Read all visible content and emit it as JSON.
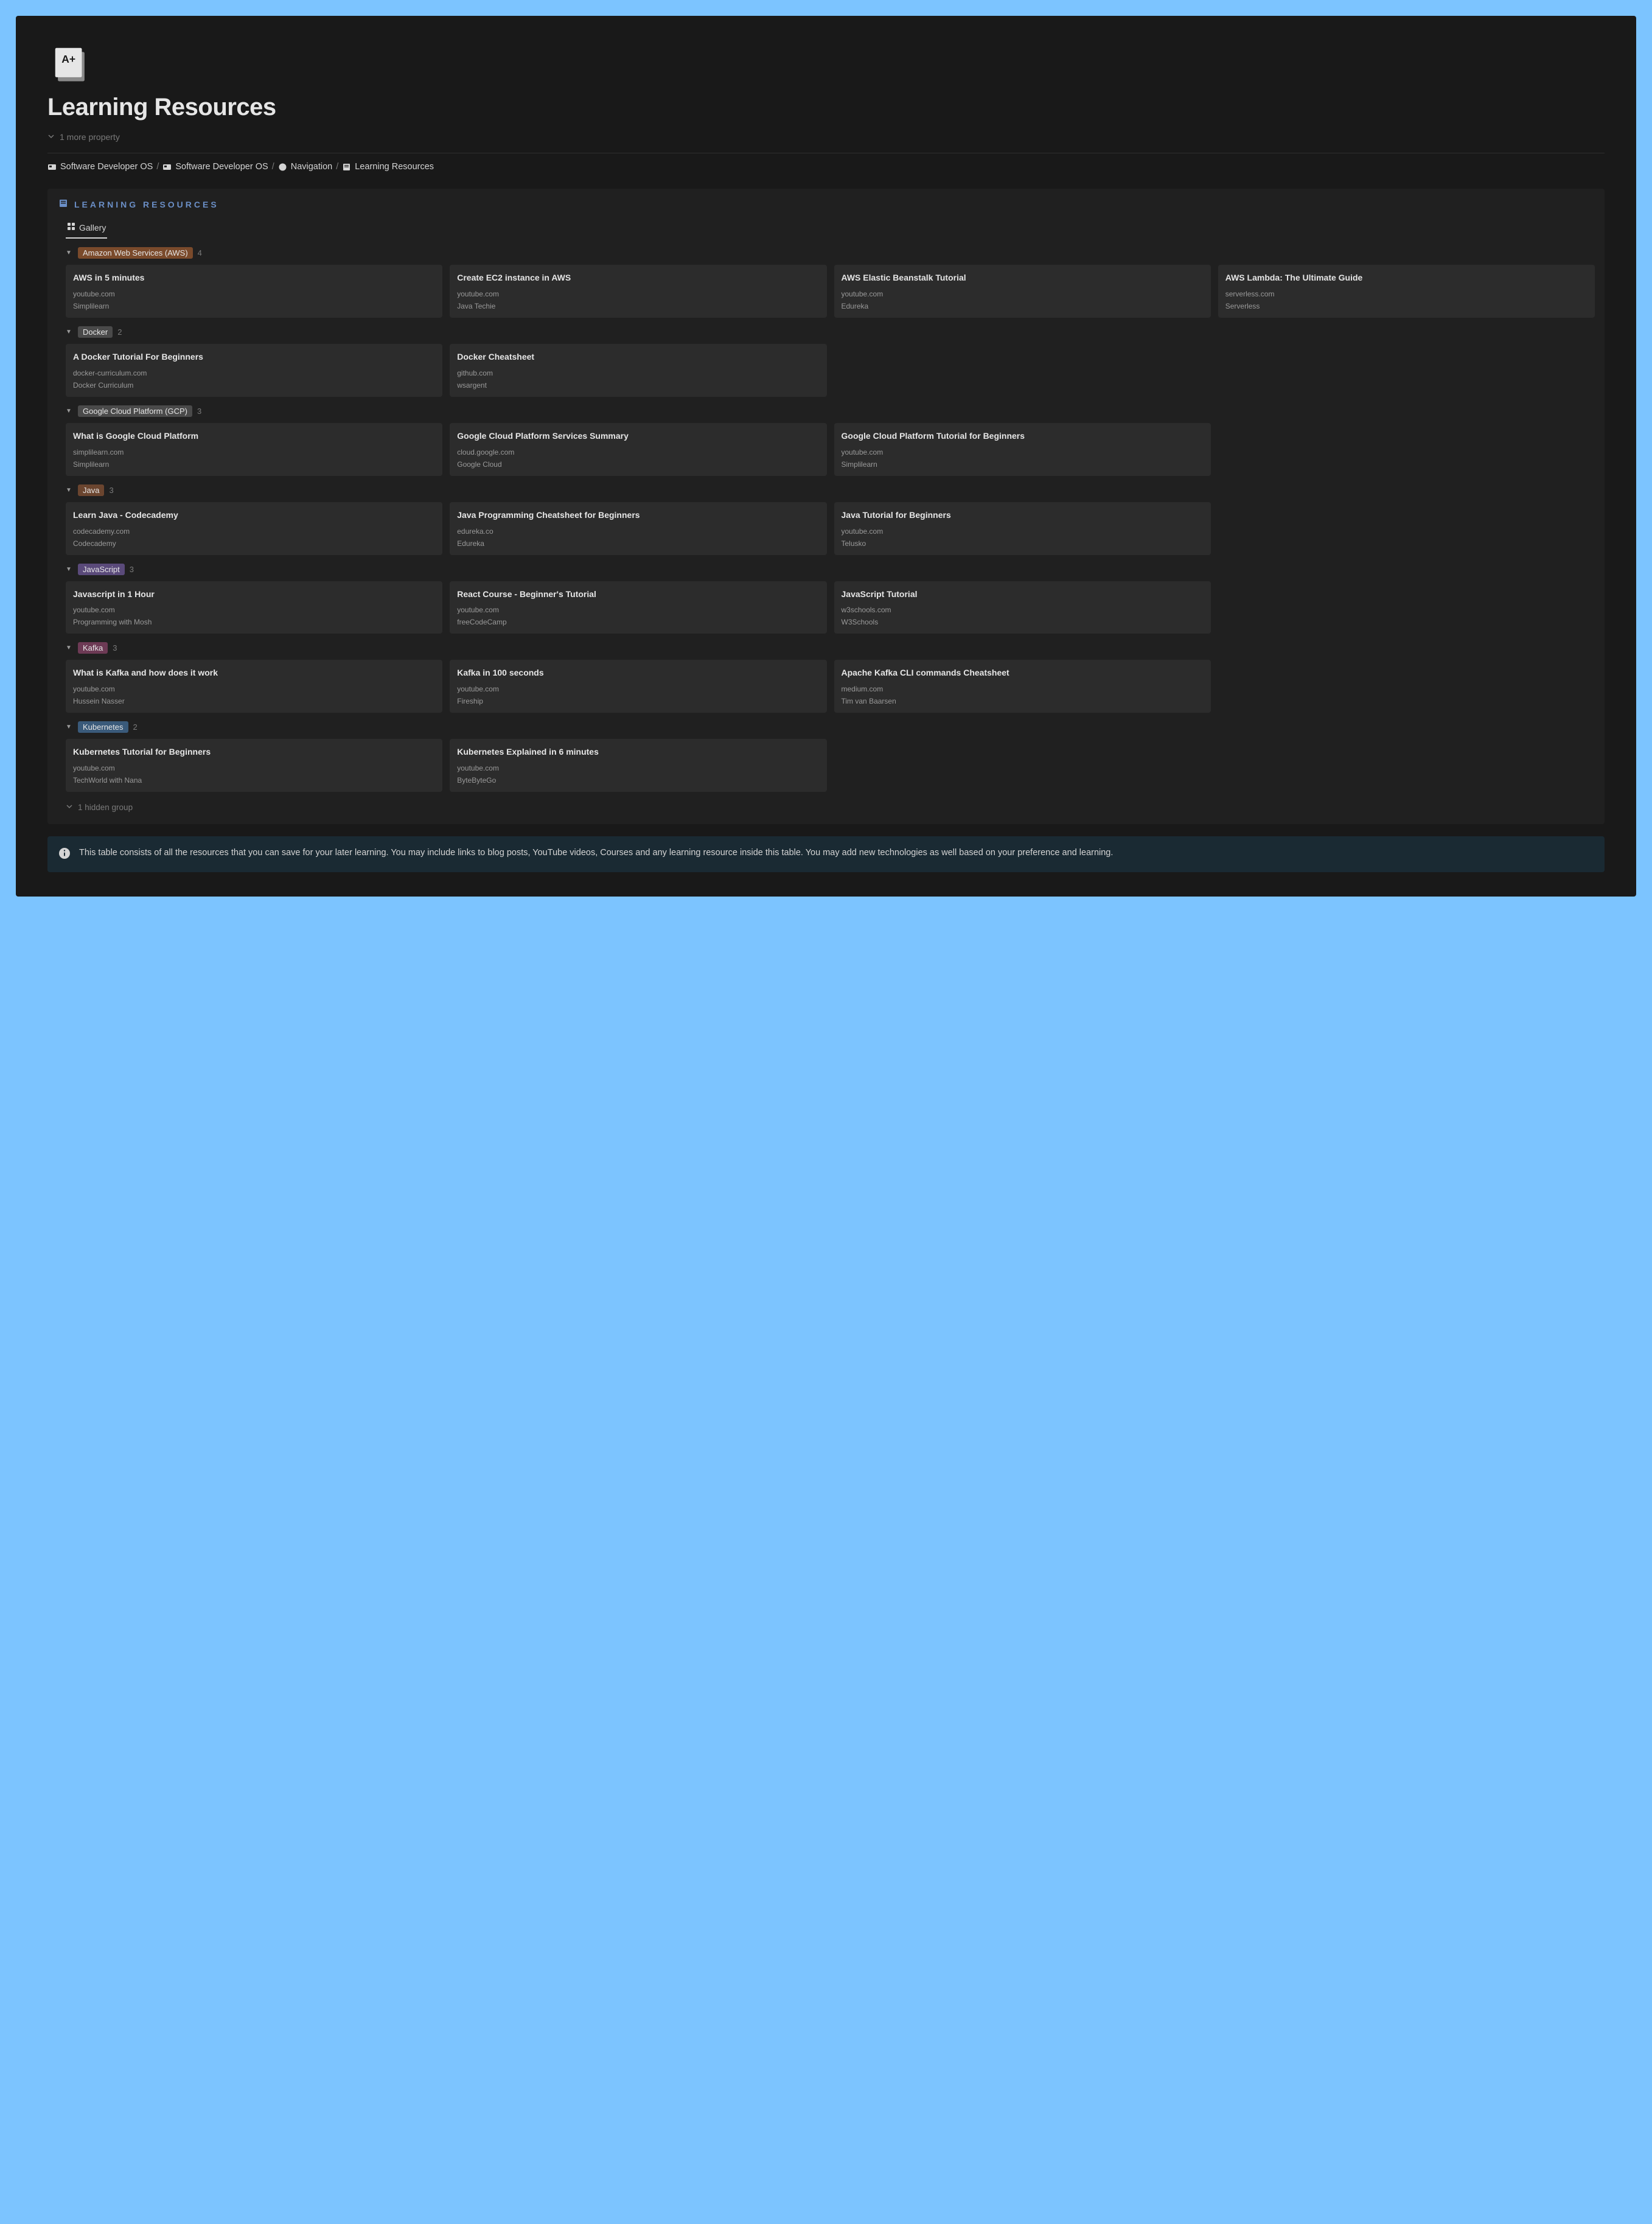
{
  "page": {
    "title": "Learning Resources",
    "more_props": "1 more property"
  },
  "breadcrumb": [
    {
      "icon": "card",
      "label": "Software Developer OS"
    },
    {
      "icon": "card",
      "label": "Software Developer OS"
    },
    {
      "icon": "compass",
      "label": "Navigation"
    },
    {
      "icon": "book",
      "label": "Learning Resources"
    }
  ],
  "database": {
    "title": "LEARNING RESOURCES",
    "view": "Gallery",
    "hidden_groups": "1 hidden group",
    "groups": [
      {
        "tag": "Amazon Web Services (AWS)",
        "tag_color": "tag-orange",
        "count": "4",
        "cards": [
          {
            "title": "AWS in 5 minutes",
            "url": "youtube.com",
            "source": "Simplilearn"
          },
          {
            "title": "Create EC2 instance in AWS",
            "url": "youtube.com",
            "source": "Java Techie"
          },
          {
            "title": "AWS Elastic Beanstalk Tutorial",
            "url": "youtube.com",
            "source": "Edureka"
          },
          {
            "title": "AWS Lambda: The Ultimate Guide",
            "url": "serverless.com",
            "source": "Serverless"
          }
        ]
      },
      {
        "tag": "Docker",
        "tag_color": "tag-gray",
        "count": "2",
        "cards": [
          {
            "title": "A Docker Tutorial For Beginners",
            "url": "docker-curriculum.com",
            "source": "Docker Curriculum"
          },
          {
            "title": "Docker Cheatsheet",
            "url": "github.com",
            "source": "wsargent"
          }
        ]
      },
      {
        "tag": "Google Cloud Platform (GCP)",
        "tag_color": "tag-gray",
        "count": "3",
        "cards": [
          {
            "title": "What is Google Cloud Platform",
            "url": "simplilearn.com",
            "source": "Simplilearn"
          },
          {
            "title": "Google Cloud Platform Services Summary",
            "url": "cloud.google.com",
            "source": "Google Cloud"
          },
          {
            "title": "Google Cloud Platform Tutorial for Beginners",
            "url": "youtube.com",
            "source": "Simplilearn"
          }
        ]
      },
      {
        "tag": "Java",
        "tag_color": "tag-brown",
        "count": "3",
        "cards": [
          {
            "title": "Learn Java - Codecademy",
            "url": "codecademy.com",
            "source": "Codecademy"
          },
          {
            "title": "Java Programming Cheatsheet for Beginners",
            "url": "edureka.co",
            "source": "Edureka"
          },
          {
            "title": "Java Tutorial for Beginners",
            "url": "youtube.com",
            "source": "Telusko"
          }
        ]
      },
      {
        "tag": "JavaScript",
        "tag_color": "tag-purple",
        "count": "3",
        "cards": [
          {
            "title": "Javascript in 1 Hour",
            "url": "youtube.com",
            "source": "Programming with Mosh"
          },
          {
            "title": "React Course - Beginner's Tutorial",
            "url": "youtube.com",
            "source": "freeCodeCamp"
          },
          {
            "title": "JavaScript Tutorial",
            "url": "w3schools.com",
            "source": "W3Schools"
          }
        ]
      },
      {
        "tag": "Kafka",
        "tag_color": "tag-pink",
        "count": "3",
        "cards": [
          {
            "title": "What is Kafka and how does it work",
            "url": "youtube.com",
            "source": "Hussein Nasser"
          },
          {
            "title": "Kafka in 100 seconds",
            "url": "youtube.com",
            "source": "Fireship"
          },
          {
            "title": "Apache Kafka CLI commands Cheatsheet",
            "url": "medium.com",
            "source": "Tim van Baarsen"
          }
        ]
      },
      {
        "tag": "Kubernetes",
        "tag_color": "tag-blue",
        "count": "2",
        "cards": [
          {
            "title": "Kubernetes Tutorial for Beginners",
            "url": "youtube.com",
            "source": "TechWorld with Nana"
          },
          {
            "title": "Kubernetes Explained in 6 minutes",
            "url": "youtube.com",
            "source": "ByteByteGo"
          }
        ]
      }
    ]
  },
  "callout": {
    "text": "This table consists of all the resources that you can save for your later learning. You may include links to blog posts, YouTube videos, Courses and any learning resource inside this table. You may add new technologies as well based on your preference and learning."
  }
}
